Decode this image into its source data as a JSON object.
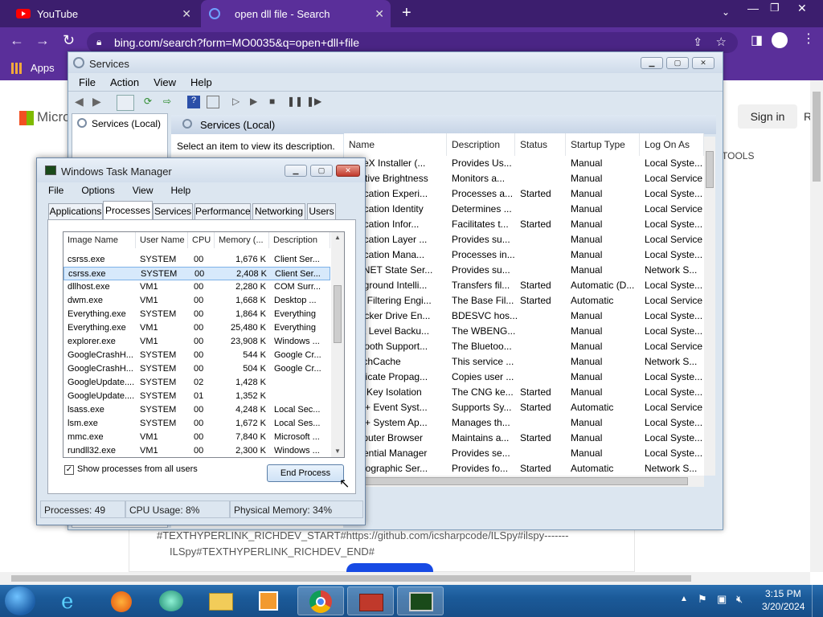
{
  "chrome": {
    "tabs": [
      {
        "title": "YouTube",
        "icon": "youtube-icon"
      },
      {
        "title": "open dll file - Search",
        "icon": "bing-icon"
      }
    ],
    "url": "bing.com/search?form=MO0035&q=open+dll+file",
    "bookmarks_apps": "Apps",
    "page": {
      "logo_text": "Micro",
      "sign_in": "Sign in",
      "sign_in_extra": "R",
      "tools": "TOOLS",
      "bullet_line1": "#TEXTHYPERLINK_RICHDEV_START#https://github.com/icsharpcode/ILSpy#ilspy-------",
      "bullet_line2": "ILSpy#TEXTHYPERLINK_RICHDEV_END#"
    }
  },
  "services": {
    "title": "Services",
    "menu": [
      "File",
      "Action",
      "View",
      "Help"
    ],
    "tree_item": "Services (Local)",
    "panel_title": "Services (Local)",
    "hint": "Select an item to view its description.",
    "columns": [
      "Name",
      "Description",
      "Status",
      "Startup Type",
      "Log On As"
    ],
    "rows": [
      [
        "ActiveX Installer (...",
        "Provides Us...",
        "",
        "Manual",
        "Local Syste..."
      ],
      [
        "Adaptive Brightness",
        "Monitors a...",
        "",
        "Manual",
        "Local Service"
      ],
      [
        "Application Experi...",
        "Processes a...",
        "Started",
        "Manual",
        "Local Syste..."
      ],
      [
        "Application Identity",
        "Determines ...",
        "",
        "Manual",
        "Local Service"
      ],
      [
        "Application Infor...",
        "Facilitates t...",
        "Started",
        "Manual",
        "Local Syste..."
      ],
      [
        "Application Layer ...",
        "Provides su...",
        "",
        "Manual",
        "Local Service"
      ],
      [
        "Application Mana...",
        "Processes in...",
        "",
        "Manual",
        "Local Syste..."
      ],
      [
        "ASP.NET State Ser...",
        "Provides su...",
        "",
        "Manual",
        "Network S..."
      ],
      [
        "Background Intelli...",
        "Transfers fil...",
        "Started",
        "Automatic (D...",
        "Local Syste..."
      ],
      [
        "Base Filtering Engi...",
        "The Base Fil...",
        "Started",
        "Automatic",
        "Local Service"
      ],
      [
        "BitLocker Drive En...",
        "BDESVC hos...",
        "",
        "Manual",
        "Local Syste..."
      ],
      [
        "Block Level Backu...",
        "The WBENG...",
        "",
        "Manual",
        "Local Syste..."
      ],
      [
        "Bluetooth Support...",
        "The Bluetoo...",
        "",
        "Manual",
        "Local Service"
      ],
      [
        "BranchCache",
        "This service ...",
        "",
        "Manual",
        "Network S..."
      ],
      [
        "Certificate Propag...",
        "Copies user ...",
        "",
        "Manual",
        "Local Syste..."
      ],
      [
        "CNG Key Isolation",
        "The CNG ke...",
        "Started",
        "Manual",
        "Local Syste..."
      ],
      [
        "COM+ Event Syst...",
        "Supports Sy...",
        "Started",
        "Automatic",
        "Local Service"
      ],
      [
        "COM+ System Ap...",
        "Manages th...",
        "",
        "Manual",
        "Local Syste..."
      ],
      [
        "Computer Browser",
        "Maintains a...",
        "Started",
        "Manual",
        "Local Syste..."
      ],
      [
        "Credential Manager",
        "Provides se...",
        "",
        "Manual",
        "Local Syste..."
      ],
      [
        "Cryptographic Ser...",
        "Provides fo...",
        "Started",
        "Automatic",
        "Network S..."
      ]
    ]
  },
  "taskmgr": {
    "title": "Windows Task Manager",
    "menu": [
      "File",
      "Options",
      "View",
      "Help"
    ],
    "tabs": [
      "Applications",
      "Processes",
      "Services",
      "Performance",
      "Networking",
      "Users"
    ],
    "columns": [
      "Image Name",
      "User Name",
      "CPU",
      "Memory (...",
      "Description"
    ],
    "rows": [
      [
        "csrss.exe",
        "SYSTEM",
        "00",
        "1,676 K",
        "Client Ser..."
      ],
      [
        "csrss.exe",
        "SYSTEM",
        "00",
        "2,408 K",
        "Client Ser..."
      ],
      [
        "dllhost.exe",
        "VM1",
        "00",
        "2,280 K",
        "COM Surr..."
      ],
      [
        "dwm.exe",
        "VM1",
        "00",
        "1,668 K",
        "Desktop ..."
      ],
      [
        "Everything.exe",
        "SYSTEM",
        "00",
        "1,864 K",
        "Everything"
      ],
      [
        "Everything.exe",
        "VM1",
        "00",
        "25,480 K",
        "Everything"
      ],
      [
        "explorer.exe",
        "VM1",
        "00",
        "23,908 K",
        "Windows ..."
      ],
      [
        "GoogleCrashH...",
        "SYSTEM",
        "00",
        "544 K",
        "Google Cr..."
      ],
      [
        "GoogleCrashH...",
        "SYSTEM",
        "00",
        "504 K",
        "Google Cr..."
      ],
      [
        "GoogleUpdate....",
        "SYSTEM",
        "02",
        "1,428 K",
        ""
      ],
      [
        "GoogleUpdate....",
        "SYSTEM",
        "01",
        "1,352 K",
        ""
      ],
      [
        "lsass.exe",
        "SYSTEM",
        "00",
        "4,248 K",
        "Local Sec..."
      ],
      [
        "lsm.exe",
        "SYSTEM",
        "00",
        "1,672 K",
        "Local Ses..."
      ],
      [
        "mmc.exe",
        "VM1",
        "00",
        "7,840 K",
        "Microsoft ..."
      ],
      [
        "rundll32.exe",
        "VM1",
        "00",
        "2,300 K",
        "Windows ..."
      ]
    ],
    "show_all_label": "Show processes from all users",
    "end_process": "End Process",
    "status": {
      "processes": "Processes: 49",
      "cpu": "CPU Usage: 8%",
      "memory": "Physical Memory: 34%"
    }
  },
  "taskbar": {
    "time": "3:15 PM",
    "date": "3/20/2024"
  }
}
